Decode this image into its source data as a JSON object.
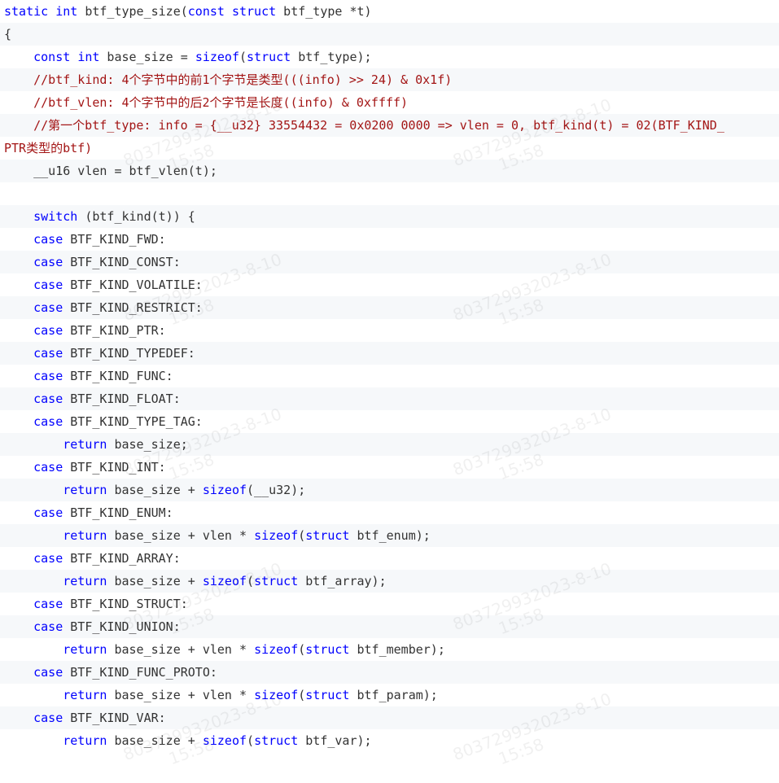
{
  "colors": {
    "keyword": "#0000ff",
    "comment": "#a31515",
    "text": "#333333",
    "stripe": "#f6f8fa"
  },
  "watermark": [
    "803729932023-8-10",
    "15:58"
  ],
  "code_lines": [
    "static int btf_type_size(const struct btf_type *t)",
    "{",
    "    const int base_size = sizeof(struct btf_type);",
    "    //btf_kind: 4个字节中的前1个字节是类型(((info) >> 24) & 0x1f)",
    "    //btf_vlen: 4个字节中的后2个字节是长度((info) & 0xffff)",
    "    //第一个btf_type: info = {__u32} 33554432 = 0x0200 0000 => vlen = 0, btf_kind(t) = 02(BTF_KIND_",
    "PTR类型的btf)",
    "    __u16 vlen = btf_vlen(t);",
    "",
    "    switch (btf_kind(t)) {",
    "    case BTF_KIND_FWD:",
    "    case BTF_KIND_CONST:",
    "    case BTF_KIND_VOLATILE:",
    "    case BTF_KIND_RESTRICT:",
    "    case BTF_KIND_PTR:",
    "    case BTF_KIND_TYPEDEF:",
    "    case BTF_KIND_FUNC:",
    "    case BTF_KIND_FLOAT:",
    "    case BTF_KIND_TYPE_TAG:",
    "        return base_size;",
    "    case BTF_KIND_INT:",
    "        return base_size + sizeof(__u32);",
    "    case BTF_KIND_ENUM:",
    "        return base_size + vlen * sizeof(struct btf_enum);",
    "    case BTF_KIND_ARRAY:",
    "        return base_size + sizeof(struct btf_array);",
    "    case BTF_KIND_STRUCT:",
    "    case BTF_KIND_UNION:",
    "        return base_size + vlen * sizeof(struct btf_member);",
    "    case BTF_KIND_FUNC_PROTO:",
    "        return base_size + vlen * sizeof(struct btf_param);",
    "    case BTF_KIND_VAR:",
    "        return base_size + sizeof(struct btf_var);"
  ]
}
